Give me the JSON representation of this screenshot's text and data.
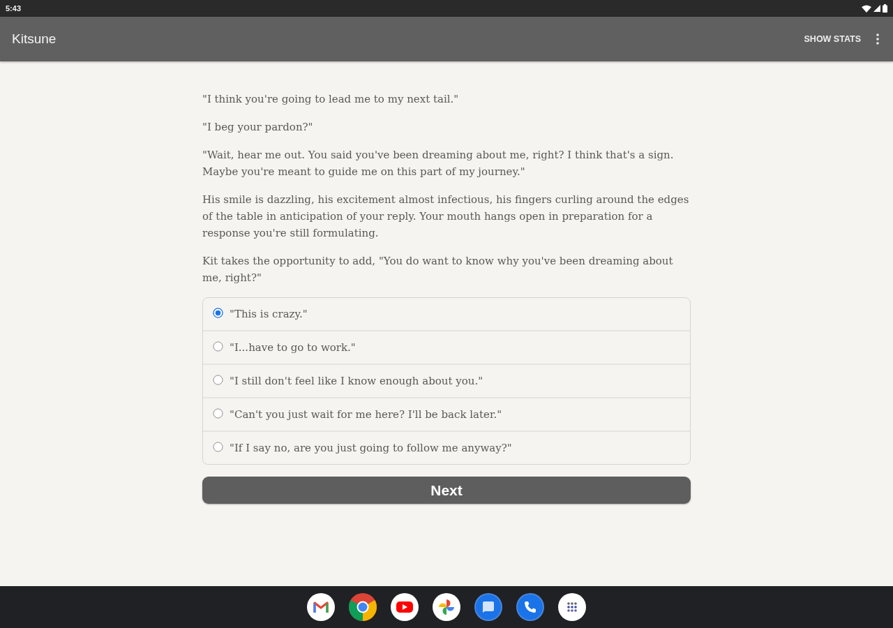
{
  "status_bar": {
    "time": "5:43"
  },
  "app_bar": {
    "title": "Kitsune",
    "action": "SHOW STATS"
  },
  "story": {
    "paragraphs": [
      "\"I think you're going to lead me to my next tail.\"",
      "\"I beg your pardon?\"",
      "\"Wait, hear me out. You said you've been dreaming about me, right? I think that's a sign. Maybe you're meant to guide me on this part of my journey.\"",
      "His smile is dazzling, his excitement almost infectious, his fingers curling around the edges of the table in anticipation of your reply. Your mouth hangs open in preparation for a response you're still formulating.",
      "Kit takes the opportunity to add, \"You do want to know why you've been dreaming about me, right?\""
    ]
  },
  "choices": [
    {
      "label": "\"This is crazy.\"",
      "selected": true
    },
    {
      "label": "\"I...have to go to work.\"",
      "selected": false
    },
    {
      "label": "\"I still don't feel like I know enough about you.\"",
      "selected": false
    },
    {
      "label": "\"Can't you just wait for me here? I'll be back later.\"",
      "selected": false
    },
    {
      "label": "\"If I say no, are you just going to follow me anyway?\"",
      "selected": false
    }
  ],
  "next_button": {
    "label": "Next"
  }
}
